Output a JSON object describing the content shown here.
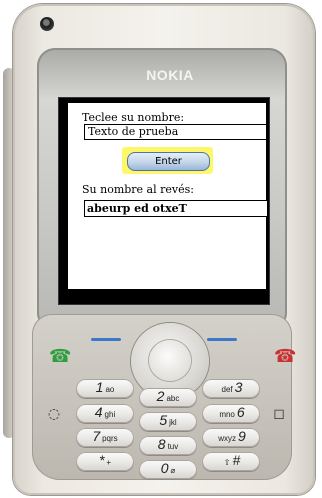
{
  "phone": {
    "brand": "NOKIA",
    "keys": {
      "k1": {
        "num": "1",
        "letters": "ao"
      },
      "k2": {
        "num": "2",
        "letters": "abc"
      },
      "k3": {
        "num": "3",
        "letters": "def"
      },
      "k4": {
        "num": "4",
        "letters": "ghi"
      },
      "k5": {
        "num": "5",
        "letters": "jkl"
      },
      "k6": {
        "num": "6",
        "letters": "mno"
      },
      "k7": {
        "num": "7",
        "letters": "pqrs"
      },
      "k8": {
        "num": "8",
        "letters": "tuv"
      },
      "k9": {
        "num": "9",
        "letters": "wxyz"
      },
      "kstar": {
        "num": "*",
        "letters": "+"
      },
      "k0": {
        "num": "0",
        "letters": "⌀"
      },
      "khash": {
        "num": "#",
        "letters": "⇧"
      }
    }
  },
  "app": {
    "prompt_label": "Teclee su nombre:",
    "name_input_value": "Texto de prueba",
    "enter_button_label": "Enter",
    "result_label": "Su nombre al revés:",
    "result_value": "abeurp ed otxeT"
  }
}
